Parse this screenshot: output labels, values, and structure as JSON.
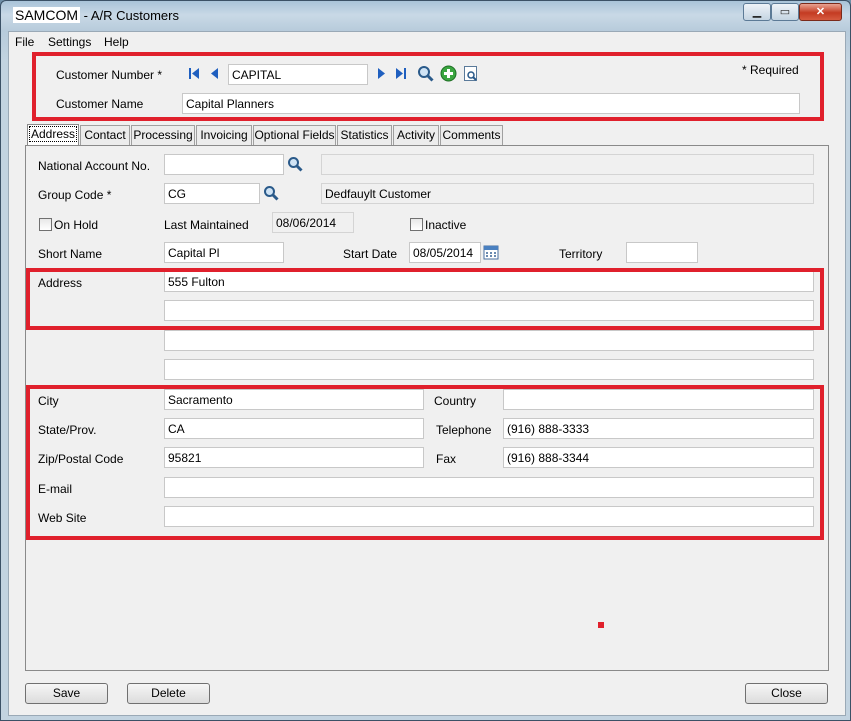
{
  "window": {
    "app_name": "SAMCOM",
    "title_rest": " - A/R Customers",
    "minimize": "▁",
    "maximize": "▭",
    "close": "✕"
  },
  "menu": {
    "file": "File",
    "settings": "Settings",
    "help": "Help"
  },
  "header": {
    "customer_number_label": "Customer Number *",
    "customer_number": "CAPITAL",
    "customer_name_label": "Customer Name",
    "customer_name": "Capital Planners",
    "required_note": "*  Required"
  },
  "tabs": [
    "Address",
    "Contact",
    "Processing",
    "Invoicing",
    "Optional Fields",
    "Statistics",
    "Activity",
    "Comments"
  ],
  "form": {
    "national_account_label": "National Account No.",
    "national_account": "",
    "national_account_desc": "",
    "group_code_label": "Group Code *",
    "group_code": "CG",
    "group_code_desc": "Dedfauylt Customer",
    "on_hold_label": "On Hold",
    "last_maintained_label": "Last Maintained",
    "last_maintained": "08/06/2014",
    "inactive_label": "Inactive",
    "short_name_label": "Short Name",
    "short_name": "Capital Pl",
    "start_date_label": "Start Date",
    "start_date": "08/05/2014",
    "territory_label": "Territory",
    "territory": "",
    "address_label": "Address",
    "address_lines": [
      "555 Fulton",
      "",
      "",
      ""
    ],
    "city_label": "City",
    "city": "Sacramento",
    "country_label": "Country",
    "country": "",
    "state_label": "State/Prov.",
    "state": "CA",
    "telephone_label": "Telephone",
    "telephone": "(916) 888-3333",
    "zip_label": "Zip/Postal Code",
    "zip": "95821",
    "fax_label": "Fax",
    "fax": "(916) 888-3344",
    "email_label": "E-mail",
    "email": "",
    "website_label": "Web Site",
    "website": ""
  },
  "footer": {
    "save": "Save",
    "delete": "Delete",
    "close": "Close"
  },
  "colors": {
    "highlight": "#e0202c",
    "nav_blue": "#1f5fbf",
    "add_green": "#3aa640"
  }
}
